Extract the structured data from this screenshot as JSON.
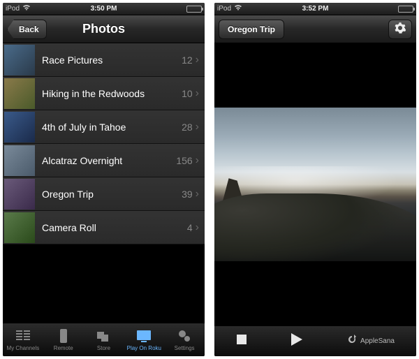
{
  "left": {
    "status": {
      "device": "iPod",
      "time": "3:50 PM"
    },
    "nav": {
      "title": "Photos",
      "back": "Back"
    },
    "albums": [
      {
        "name": "Race Pictures",
        "count": 12
      },
      {
        "name": "Hiking in the Redwoods",
        "count": 10
      },
      {
        "name": "4th of July in Tahoe",
        "count": 28
      },
      {
        "name": "Alcatraz Overnight",
        "count": 156
      },
      {
        "name": "Oregon Trip",
        "count": 39
      },
      {
        "name": "Camera Roll",
        "count": 4
      }
    ],
    "tabs": [
      {
        "label": "My Channels"
      },
      {
        "label": "Remote"
      },
      {
        "label": "Store"
      },
      {
        "label": "Play On Roku"
      },
      {
        "label": "Settings"
      }
    ],
    "active_tab_index": 3
  },
  "right": {
    "status": {
      "device": "iPod",
      "time": "3:52 PM"
    },
    "nav": {
      "album": "Oregon Trip"
    },
    "toolbar": {
      "refresh_label": "AppleSana"
    }
  }
}
